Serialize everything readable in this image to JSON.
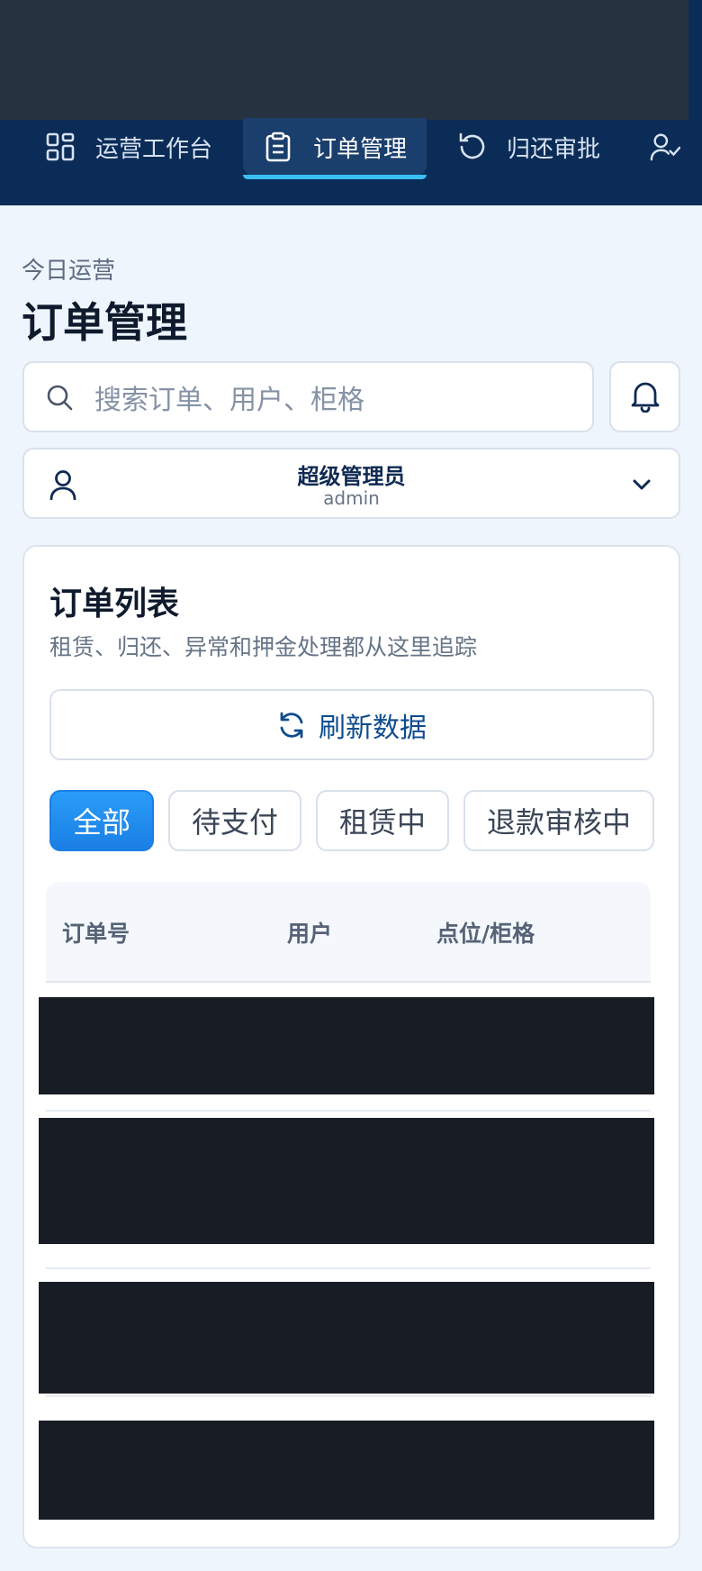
{
  "nav": {
    "items": [
      {
        "label": "运营工作台",
        "icon": "dashboard-grid-icon",
        "active": false
      },
      {
        "label": "订单管理",
        "icon": "clipboard-icon",
        "active": true
      },
      {
        "label": "归还审批",
        "icon": "rotate-ccw-icon",
        "active": false
      },
      {
        "label": "",
        "icon": "user-check-icon",
        "active": false
      }
    ]
  },
  "page": {
    "eyebrow": "今日运营",
    "title": "订单管理"
  },
  "search": {
    "placeholder": "搜索订单、用户、柜格",
    "icon": "search-icon"
  },
  "notifications": {
    "icon": "bell-icon"
  },
  "user": {
    "name": "超级管理员",
    "role": "admin",
    "icon": "user-icon"
  },
  "card": {
    "title": "订单列表",
    "subtitle": "租赁、归还、异常和押金处理都从这里追踪",
    "refresh_label": "刷新数据",
    "filters": [
      {
        "label": "全部",
        "active": true
      },
      {
        "label": "待支付",
        "active": false
      },
      {
        "label": "租赁中",
        "active": false
      },
      {
        "label": "退款审核中",
        "active": false
      }
    ],
    "table": {
      "columns": [
        "订单号",
        "用户",
        "点位/柜格"
      ]
    }
  },
  "colors": {
    "header_bg": "#0b2c57",
    "accent": "#1a7fe5",
    "active_underline": "#3ac0f2",
    "page_bg": "#eef5fd"
  }
}
